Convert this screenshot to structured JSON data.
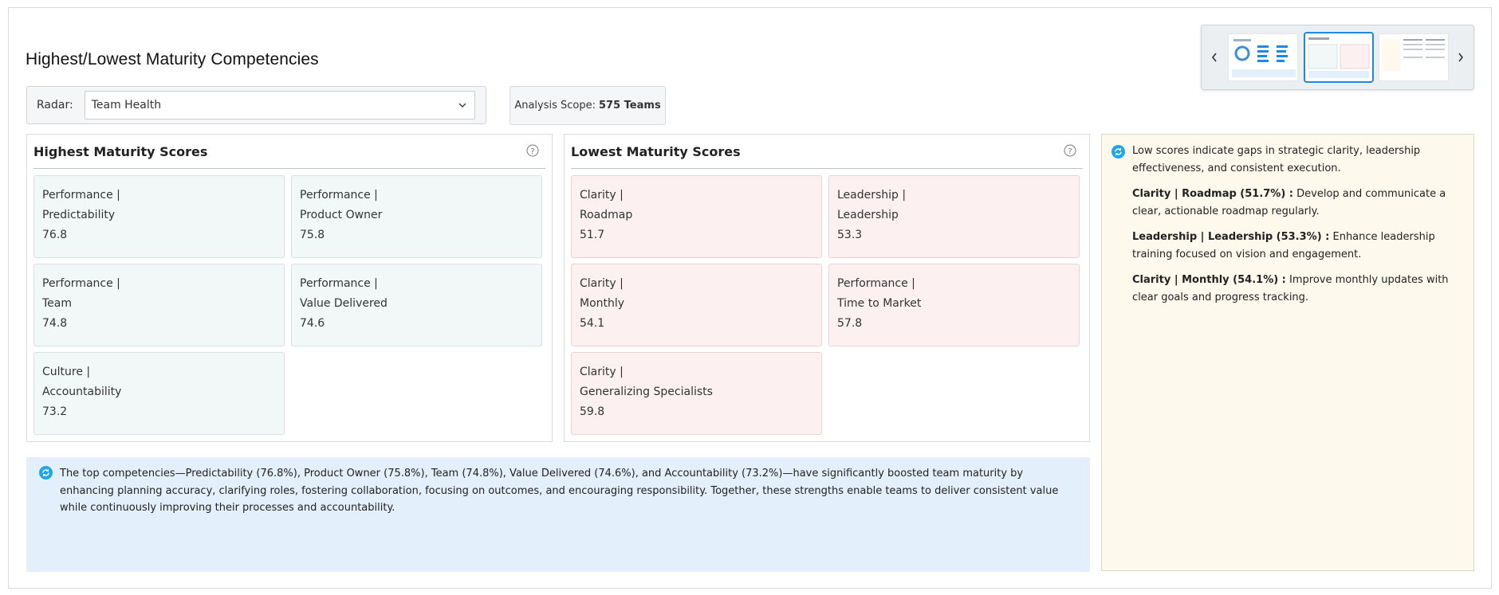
{
  "page": {
    "title": "Highest/Lowest Maturity Competencies"
  },
  "radar": {
    "label": "Radar:",
    "selected": "Team Health"
  },
  "scope": {
    "label": "Analysis Scope:",
    "value": "575 Teams"
  },
  "carousel": {
    "prev_icon": "chevron-left-icon",
    "next_icon": "chevron-right-icon",
    "active_index": 1
  },
  "highest": {
    "title": "Highest Maturity Scores",
    "items": [
      {
        "category": "Performance |",
        "name": "Predictability",
        "score": "76.8"
      },
      {
        "category": "Performance |",
        "name": "Product Owner",
        "score": "75.8"
      },
      {
        "category": "Performance |",
        "name": "Team",
        "score": "74.8"
      },
      {
        "category": "Performance |",
        "name": "Value Delivered",
        "score": "74.6"
      },
      {
        "category": "Culture |",
        "name": "Accountability",
        "score": "73.2"
      }
    ]
  },
  "lowest": {
    "title": "Lowest Maturity Scores",
    "items": [
      {
        "category": "Clarity |",
        "name": "Roadmap",
        "score": "51.7"
      },
      {
        "category": "Leadership |",
        "name": "Leadership",
        "score": "53.3"
      },
      {
        "category": "Clarity |",
        "name": "Monthly",
        "score": "54.1"
      },
      {
        "category": "Performance |",
        "name": "Time to Market",
        "score": "57.8"
      },
      {
        "category": "Clarity |",
        "name": "Generalizing Specialists",
        "score": "59.8"
      }
    ]
  },
  "summary": {
    "text": "The top competencies—Predictability (76.8%), Product Owner (75.8%), Team (74.8%), Value Delivered (74.6%), and Accountability (73.2%)—have significantly boosted team maturity by enhancing planning accuracy, clarifying roles, fostering collaboration, focusing on outcomes, and encouraging responsibility. Together, these strengths enable teams to deliver consistent value while continuously improving their processes and accountability."
  },
  "recommendations": {
    "intro": "Low scores indicate gaps in strategic clarity, leadership effectiveness, and consistent execution.",
    "items": [
      {
        "title": "Clarity | Roadmap (51.7%) :",
        "text": " Develop and communicate a clear, actionable roadmap regularly."
      },
      {
        "title": "Leadership | Leadership (53.3%) :",
        "text": " Enhance leadership training focused on vision and engagement."
      },
      {
        "title": "Clarity | Monthly (54.1%) :",
        "text": " Improve monthly updates with clear goals and progress tracking."
      }
    ]
  },
  "colors": {
    "accent": "#1e88e5",
    "high_card": "#f2f8f8",
    "low_card": "#fcf0f0",
    "summary_bg": "#e3effa",
    "recs_bg": "#fdf9ec"
  }
}
